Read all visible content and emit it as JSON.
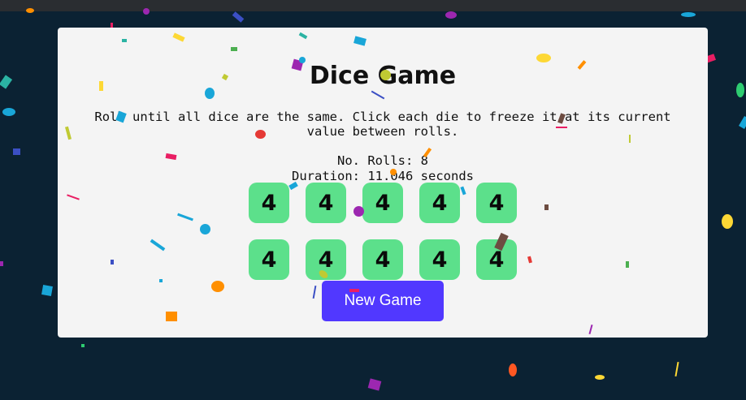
{
  "game": {
    "title": "Dice Game",
    "instructions": "Roll until all dice are the same. Click each die to freeze it at its current value between rolls.",
    "rolls_label": "No. Rolls: 8",
    "duration_label": "Duration: 11.046 seconds",
    "rolls": 8,
    "duration_seconds": 11.046,
    "dice": [
      4,
      4,
      4,
      4,
      4,
      4,
      4,
      4,
      4,
      4
    ],
    "new_game_label": "New Game"
  },
  "colors": {
    "page_background": "#0b2233",
    "card_background": "#f4f4f4",
    "die_background": "#5ce08b",
    "button_background": "#5138ff",
    "button_text": "#ffffff"
  },
  "decorations": {
    "effect": "confetti"
  }
}
